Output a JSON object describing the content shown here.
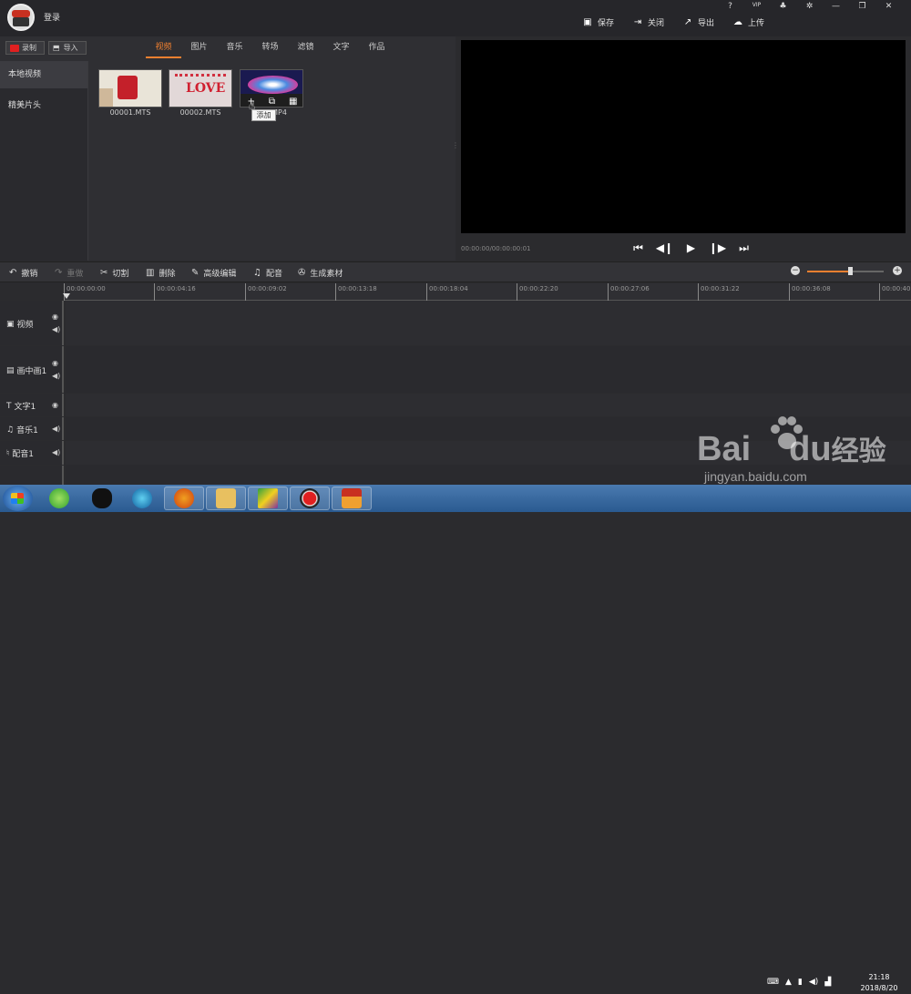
{
  "header": {
    "login_label": "登录",
    "sys": {
      "help": "?",
      "vip": "VIP",
      "bell": "bell-icon",
      "settings": "gear-icon",
      "min": "—",
      "restore": "❐",
      "close": "✕"
    },
    "actions": [
      {
        "label": "保存",
        "icon": "save-icon"
      },
      {
        "label": "关闭",
        "icon": "exit-icon"
      },
      {
        "label": "导出",
        "icon": "export-icon"
      },
      {
        "label": "上传",
        "icon": "cloud-upload-icon"
      }
    ]
  },
  "library": {
    "record_label": "录制",
    "import_label": "导入",
    "tabs": [
      "视频",
      "图片",
      "音乐",
      "转场",
      "滤镜",
      "文字",
      "作品"
    ],
    "active_tab": "视频",
    "sidebar": [
      "本地视频",
      "精美片头"
    ],
    "items": [
      {
        "name": "00001.MTS"
      },
      {
        "name": "00002.MTS"
      },
      {
        "name": "M        0.MP4"
      }
    ],
    "tooltip": "添加"
  },
  "preview": {
    "time": "00:00:00/00:00:00:01"
  },
  "toolbar": {
    "undo": "撤销",
    "redo": "重做",
    "cut": "切割",
    "delete": "删除",
    "advanced": "高级编辑",
    "dub": "配音",
    "generate": "生成素材",
    "zoom_level": 0.56
  },
  "ruler": [
    "00:00:00:00",
    "00:00:04:16",
    "00:00:09:02",
    "00:00:13:18",
    "00:00:18:04",
    "00:00:22:20",
    "00:00:27:06",
    "00:00:31:22",
    "00:00:36:08",
    "00:00:40"
  ],
  "tracks": [
    {
      "label": "视频",
      "icon": "play-icon"
    },
    {
      "label": "画中画1",
      "icon": "pip-icon"
    },
    {
      "label": "文字1",
      "icon": "text-icon"
    },
    {
      "label": "音乐1",
      "icon": "music-icon"
    },
    {
      "label": "配音1",
      "icon": "mic-icon"
    }
  ],
  "taskbar": {
    "time": "21:18",
    "date": "2018/8/20"
  },
  "watermark": {
    "brand": "Bai",
    "brand2": "du",
    "cn": "经验",
    "url": "jingyan.baidu.com"
  }
}
